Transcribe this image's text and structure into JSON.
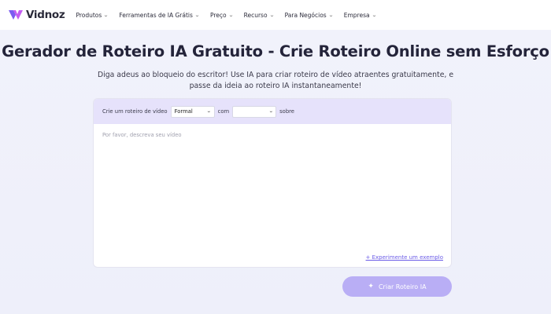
{
  "nav": {
    "logo_text": "Vidnoz",
    "items": [
      {
        "label": "Produtos"
      },
      {
        "label": "Ferramentas de IA Grátis"
      },
      {
        "label": "Preço"
      },
      {
        "label": "Recurso"
      },
      {
        "label": "Para Negócios"
      },
      {
        "label": "Empresa"
      }
    ]
  },
  "hero": {
    "title": "Gerador de Roteiro IA Gratuito - Crie Roteiro Online sem Esforço",
    "subtitle_line1": "Diga adeus ao bloqueio do escritor! Use IA para criar roteiro de vídeo atraentes gratuitamente, e",
    "subtitle_line2": "passe da ideia ao roteiro IA instantaneamente!"
  },
  "form": {
    "prefix_label": "Crie um roteiro de vídeo",
    "style_selected": "Formal",
    "with_label": "com",
    "language_selected": "",
    "about_label": "sobre",
    "textarea_placeholder": "Por favor, descreva seu vídeo",
    "example_link": "+ Experimente um exemplo"
  },
  "action": {
    "create_label": "Criar Roteiro IA"
  },
  "colors": {
    "accent": "#6b5ce7",
    "button": "#b9aef5",
    "header_band": "#e6e2fb"
  }
}
